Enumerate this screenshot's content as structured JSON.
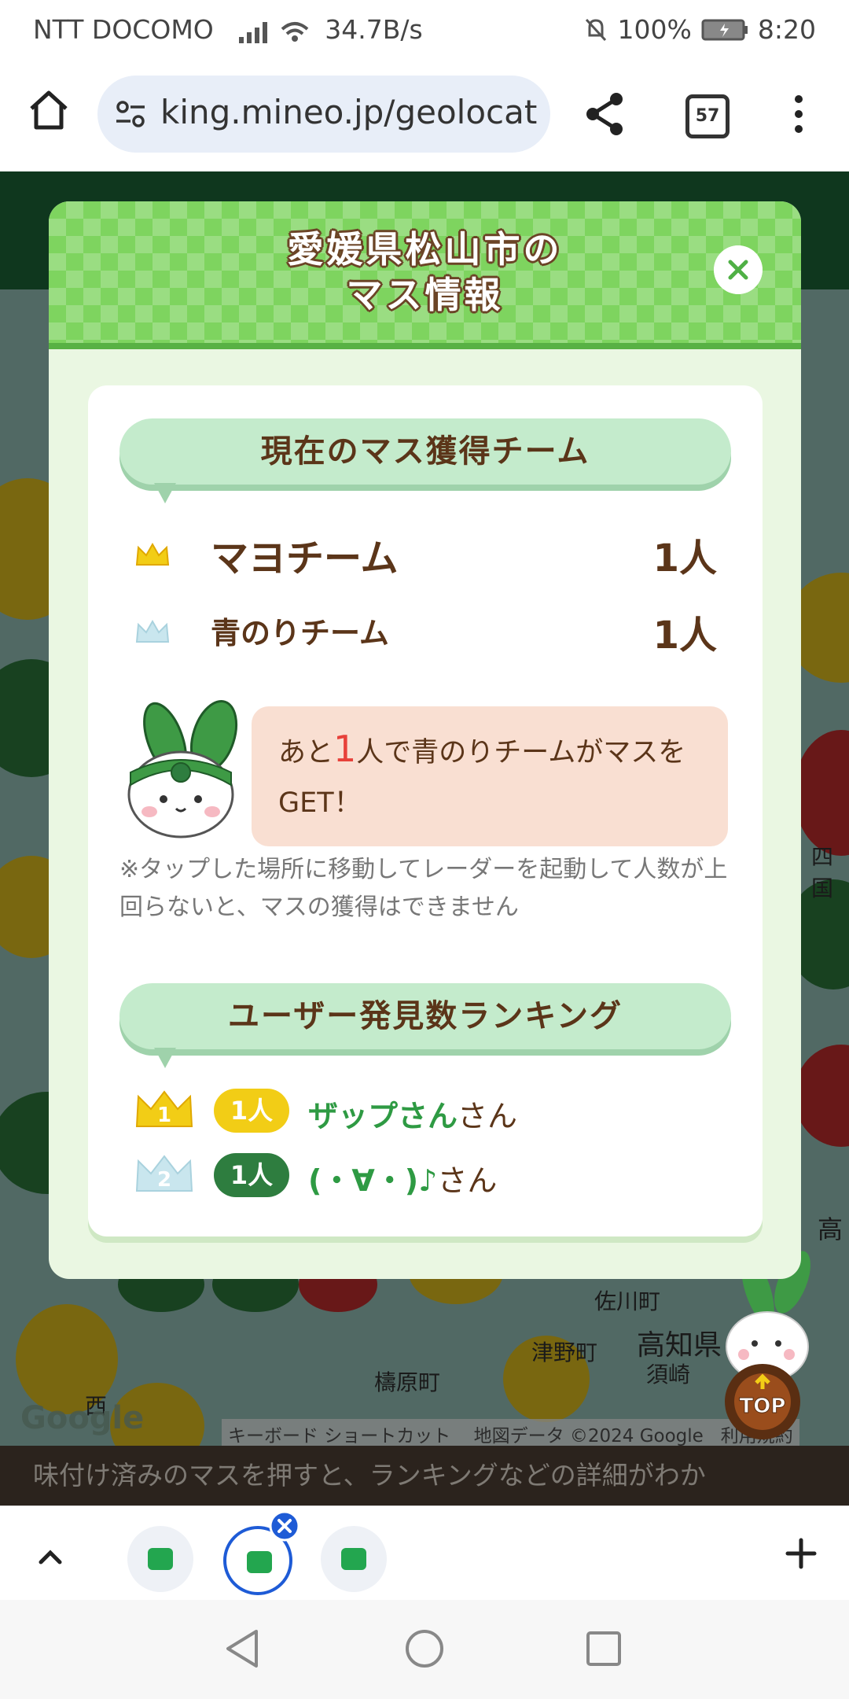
{
  "status_bar": {
    "carrier": "NTT DOCOMO",
    "net_speed": "34.7B/s",
    "battery": "100%",
    "time": "8:20"
  },
  "browser": {
    "url": "king.mineo.jp/geolocat",
    "tab_count": "57"
  },
  "modal": {
    "title_line1": "愛媛県松山市の",
    "title_line2": "マス情報",
    "current_team_header": "現在のマス獲得チーム",
    "teams": [
      {
        "name": "マヨチーム",
        "count": "1人",
        "crown": "gold"
      },
      {
        "name": "青のりチーム",
        "count": "1人",
        "crown": "blue"
      }
    ],
    "notice": {
      "prefix": "あと",
      "number": "1",
      "suffix": "人で青のりチームがマスをGET！"
    },
    "disclaimer": "※タップした場所に移動してレーダーを起動して人数が上回らないと、マスの獲得はできません",
    "ranking_header": "ユーザー発見数ランキング",
    "ranking": [
      {
        "rank": "1",
        "count": "1人",
        "user": "ザップさん",
        "suffix": "さん",
        "pill_color": "#f2cd16"
      },
      {
        "rank": "2",
        "count": "1人",
        "user": "(・∀・)♪",
        "suffix": "さん",
        "pill_color": "#2e7d3f"
      }
    ]
  },
  "map": {
    "labels": [
      "四国",
      "高",
      "佐川町",
      "高知県",
      "津野町",
      "須崎",
      "檮原町",
      "西"
    ],
    "google": "Google",
    "shortcuts": "キーボード ショートカット",
    "map_data": "地図データ ©2024 Google",
    "terms": "利用規約"
  },
  "top_button": "TOP",
  "bottom_message": "味付け済みのマスを押すと、ランキングなどの詳細がわか",
  "colors": {
    "accent_green": "#7ed45f",
    "brown": "#5b3519",
    "highlight_red": "#e7413a"
  }
}
